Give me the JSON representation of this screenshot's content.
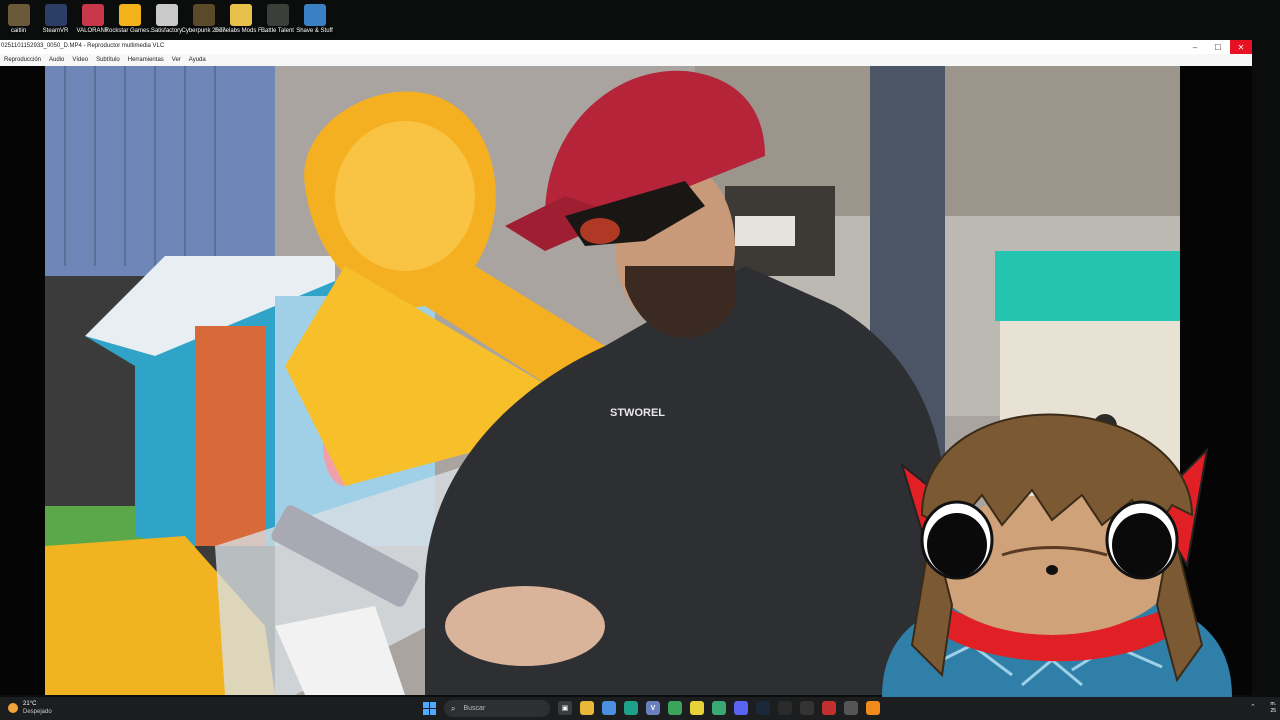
{
  "desktop": {
    "icons": [
      {
        "label": "caitlin",
        "icon": "user-folder-icon",
        "color": "#6b5a3a"
      },
      {
        "label": "SteamVR",
        "icon": "steamvr-icon",
        "color": "#2b3f66"
      },
      {
        "label": "VALORANT",
        "icon": "valorant-icon",
        "color": "#c8374a"
      },
      {
        "label": "Rockstar Games...",
        "icon": "rockstar-icon",
        "color": "#f2b31a"
      },
      {
        "label": "Satisfactory",
        "icon": "satisfactory-icon",
        "color": "#c9c9c9"
      },
      {
        "label": "Cyberpunk 2077",
        "icon": "cyberpunk-icon",
        "color": "#5a4a2a"
      },
      {
        "label": "Bonelabs Mods F...",
        "icon": "folder-icon",
        "color": "#e8c14a"
      },
      {
        "label": "Battle Talent",
        "icon": "battle-talent-icon",
        "color": "#3a3f3a"
      },
      {
        "label": "Shave & Stuff",
        "icon": "shave-stuff-icon",
        "color": "#3b7fc4"
      }
    ]
  },
  "vlc": {
    "title": "0251101152933_0050_D.MP4 - Reproductor multimedia VLC",
    "menu": [
      "Reproducción",
      "Audio",
      "Vídeo",
      "Subtítulo",
      "Herramientas",
      "Ver",
      "Ayuda"
    ],
    "window_buttons": {
      "minimize": "–",
      "maximize": "☐",
      "close": "✕"
    },
    "video_text": {
      "hoodie_print": "STWOREL"
    }
  },
  "taskbar": {
    "weather": {
      "temp": "21°C",
      "condition": "Despejado"
    },
    "search_placeholder": "Buscar",
    "apps": [
      {
        "icon": "task-view-icon",
        "glyph": "▣",
        "color": "#3a3d40"
      },
      {
        "icon": "file-explorer-icon",
        "glyph": "",
        "color": "#e8b83a"
      },
      {
        "icon": "copilot-icon",
        "glyph": "",
        "color": "#4a8fe0"
      },
      {
        "icon": "edge-icon",
        "glyph": "",
        "color": "#1ea08a"
      },
      {
        "icon": "vscode-icon",
        "glyph": "V",
        "color": "#6a7fbd"
      },
      {
        "icon": "app-green-icon",
        "glyph": "",
        "color": "#3aa55a"
      },
      {
        "icon": "sticky-notes-icon",
        "glyph": "",
        "color": "#e8d23a"
      },
      {
        "icon": "app-green2-icon",
        "glyph": "",
        "color": "#3aa870"
      },
      {
        "icon": "discord-icon",
        "glyph": "",
        "color": "#5865f2"
      },
      {
        "icon": "steam-icon",
        "glyph": "",
        "color": "#1b2838"
      },
      {
        "icon": "store-icon",
        "glyph": "",
        "color": "#2a2a2a"
      },
      {
        "icon": "obs-icon",
        "glyph": "",
        "color": "#333"
      },
      {
        "icon": "recorder-icon",
        "glyph": "",
        "color": "#c03030"
      },
      {
        "icon": "settings-icon",
        "glyph": "",
        "color": "#555"
      },
      {
        "icon": "vlc-icon",
        "glyph": "",
        "color": "#f08a1a"
      }
    ],
    "clock_time": "m.",
    "clock_date": "25"
  }
}
